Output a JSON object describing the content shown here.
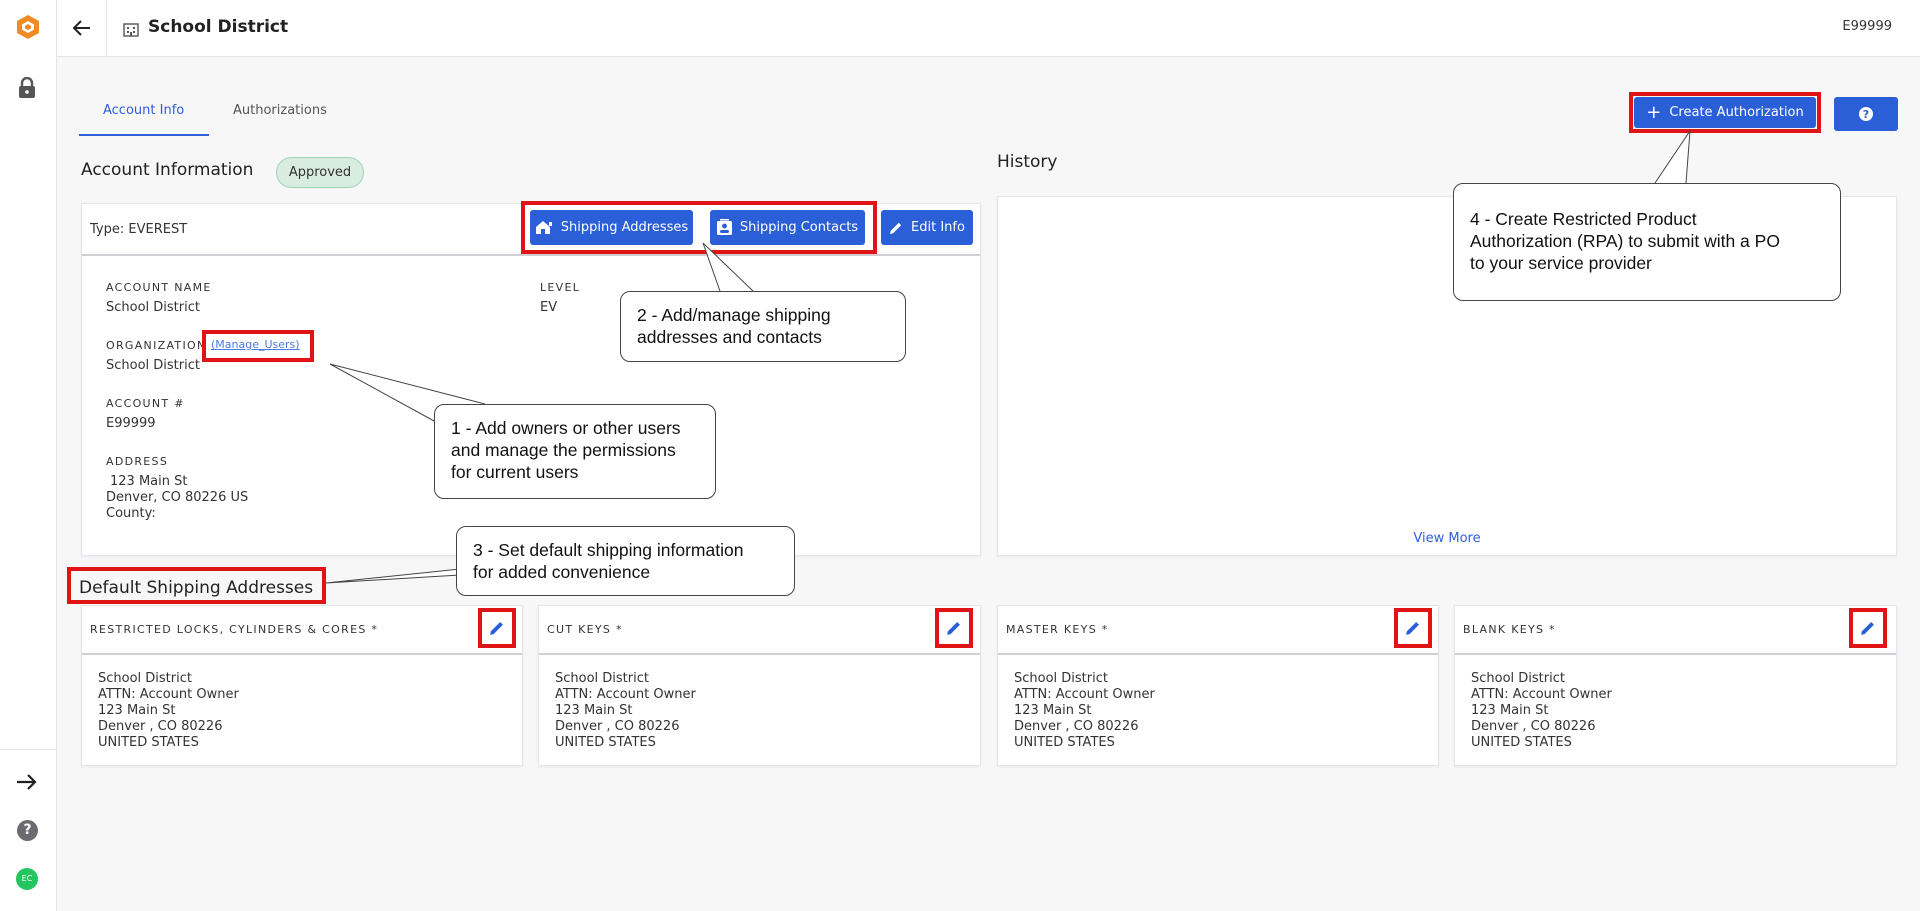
{
  "topbar": {
    "title": "School District",
    "account_code": "E99999"
  },
  "tabs": [
    {
      "label": "Account Info"
    },
    {
      "label": "Authorizations"
    }
  ],
  "actions": {
    "create_authorization": "Create Authorization"
  },
  "account": {
    "section_title": "Account Information",
    "status": "Approved",
    "type_label": "Type: EVEREST",
    "shipping_addresses_btn": "Shipping Addresses",
    "shipping_contacts_btn": "Shipping Contacts",
    "edit_info_btn": "Edit Info",
    "account_name_label": "ACCOUNT NAME",
    "account_name": "School District",
    "level_label": "LEVEL",
    "level": "EV",
    "organization_label": "ORGANIZATION",
    "manage_users_link": "(Manage_Users)",
    "organization": "School District",
    "account_number_label": "ACCOUNT #",
    "account_number": "E99999",
    "address_label": "ADDRESS",
    "address_line1": "123 Main St",
    "address_line2": "Denver, CO 80226 US",
    "county": "County:"
  },
  "history": {
    "title": "History",
    "view_more": "View More"
  },
  "shipping": {
    "section_title": "Default Shipping Addresses",
    "cards": [
      {
        "title": "RESTRICTED LOCKS, CYLINDERS & CORES *",
        "lines": [
          "School District",
          "ATTN: Account Owner",
          "123 Main St",
          "Denver , CO 80226",
          "UNITED STATES"
        ]
      },
      {
        "title": "CUT KEYS *",
        "lines": [
          "School District",
          "ATTN: Account Owner",
          "123 Main St",
          "Denver , CO 80226",
          "UNITED STATES"
        ]
      },
      {
        "title": "MASTER KEYS *",
        "lines": [
          "School District",
          "ATTN: Account Owner",
          "123 Main St",
          "Denver , CO 80226",
          "UNITED STATES"
        ]
      },
      {
        "title": "BLANK KEYS *",
        "lines": [
          "School District",
          "ATTN: Account Owner",
          "123 Main St",
          "Denver , CO 80226",
          "UNITED STATES"
        ]
      }
    ]
  },
  "callouts": {
    "c1": [
      "1 - Add owners or other users",
      "and manage the permissions",
      "for current users"
    ],
    "c2": [
      "2 - Add/manage shipping",
      "addresses and contacts"
    ],
    "c3": [
      "3 - Set default shipping information",
      "for added convenience"
    ],
    "c4": [
      "4 - Create Restricted Product",
      "Authorization (RPA) to submit with a PO",
      "to your service provider"
    ]
  },
  "rail": {
    "avatar_initials": "EC",
    "help_glyph": "?"
  },
  "icons": [
    "logo-icon",
    "lock-icon",
    "back-arrow-icon",
    "building-icon",
    "plus-icon",
    "question-icon",
    "house-icon",
    "contact-card-icon",
    "pencil-icon",
    "collapse-arrow-icon"
  ],
  "colors": {
    "accent": "#2a5fd8",
    "annotation_red": "#e01414",
    "approved_badge": "#d8ecdf"
  }
}
